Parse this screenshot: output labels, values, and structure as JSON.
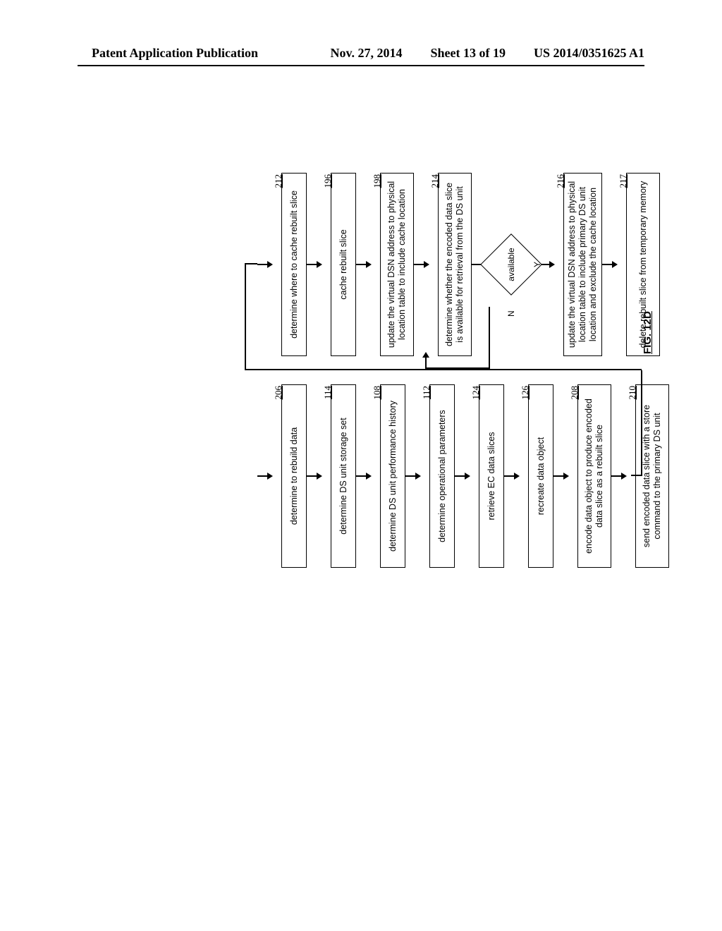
{
  "header": {
    "left": "Patent Application Publication",
    "date": "Nov. 27, 2014",
    "sheet": "Sheet 13 of 19",
    "docnum": "US 2014/0351625 A1"
  },
  "figure_label": "FIG. 12D",
  "left_steps": [
    {
      "num": "206",
      "text": "determine to rebuild data"
    },
    {
      "num": "114",
      "text": "determine DS unit storage set"
    },
    {
      "num": "108",
      "text": "determine DS unit performance history"
    },
    {
      "num": "112",
      "text": "determine operational parameters"
    },
    {
      "num": "124",
      "text": "retrieve EC data slices"
    },
    {
      "num": "126",
      "text": "recreate data object"
    },
    {
      "num": "208",
      "text": "encode data object to produce encoded data slice as a rebuilt slice"
    },
    {
      "num": "210",
      "text": "send encoded data slice with a store command to the primary DS unit"
    }
  ],
  "right_steps": [
    {
      "num": "212",
      "text": "determine where to cache rebuilt slice"
    },
    {
      "num": "196",
      "text": "cache rebuilt slice"
    },
    {
      "num": "198",
      "text": "update the virtual DSN address to physical location table to include cache location"
    },
    {
      "num": "214",
      "text": "determine whether the encoded data slice is available for retrieval from the DS unit"
    }
  ],
  "right_steps_after": [
    {
      "num": "216",
      "text": "update the virtual DSN address to physical location table to include primary DS unit location and exclude the cache location"
    },
    {
      "num": "217",
      "text": "delete rebuilt slice from temporary memory"
    }
  ],
  "diamond": {
    "label": "available",
    "no": "N",
    "yes": "Y"
  }
}
